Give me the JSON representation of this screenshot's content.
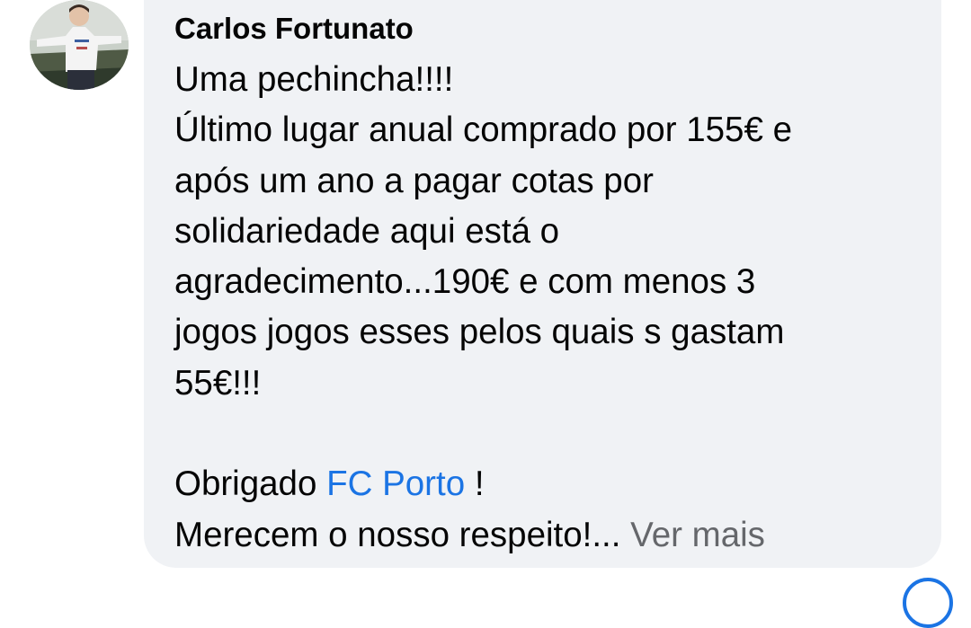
{
  "comment": {
    "author": "Carlos Fortunato",
    "lines": [
      "Uma pechincha!!!!",
      "Último lugar anual comprado por 155€ e",
      "após um ano a pagar cotas por",
      "solidariedade aqui está o",
      "agradecimento...190€ e com menos 3",
      "jogos jogos esses pelos quais s gastam",
      "55€!!!",
      ""
    ],
    "thanks_prefix": "Obrigado ",
    "mention": "FC Porto",
    "thanks_suffix": " !",
    "last_line": "Merecem o nosso respeito!...",
    "see_more": " Ver mais"
  },
  "colors": {
    "bubble": "#f0f2f5",
    "mention": "#1b74e4",
    "see_more": "#65676b"
  }
}
